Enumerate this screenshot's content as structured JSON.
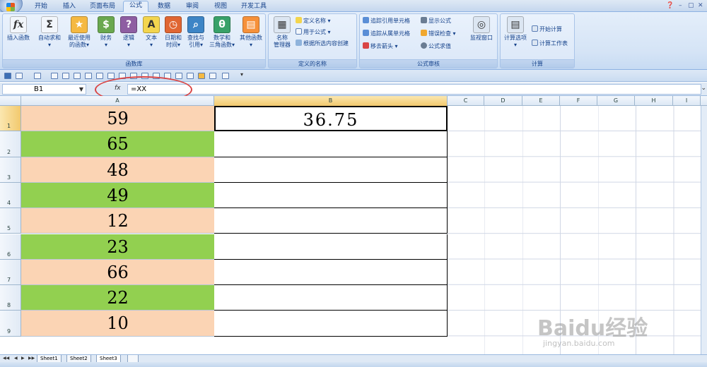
{
  "tabs": [
    "开始",
    "插入",
    "页面布局",
    "公式",
    "数据",
    "审阅",
    "视图",
    "开发工具"
  ],
  "active_tab": "公式",
  "ribbon": {
    "groups": [
      {
        "label": "函数库"
      },
      {
        "label": "定义的名称"
      },
      {
        "label": "公式审核"
      },
      {
        "label": "计算"
      }
    ],
    "function_library": [
      {
        "l1": "插入函数",
        "l2": "",
        "icon": "fx",
        "color": "#f2f6fb"
      },
      {
        "l1": "自动求和",
        "l2": "▾",
        "icon": "Σ",
        "color": "#f2f6fb"
      },
      {
        "l1": "最近使用",
        "l2": "的函数▾",
        "icon": "★",
        "color": "#f5b942"
      },
      {
        "l1": "财务",
        "l2": "▾",
        "icon": "$",
        "color": "#6aa84f"
      },
      {
        "l1": "逻辑",
        "l2": "▾",
        "icon": "?",
        "color": "#8e5ea2"
      },
      {
        "l1": "文本",
        "l2": "▾",
        "icon": "A",
        "color": "#f3d54e"
      },
      {
        "l1": "日期和",
        "l2": "时间▾",
        "icon": "◷",
        "color": "#e06633"
      },
      {
        "l1": "查找与",
        "l2": "引用▾",
        "icon": "⌕",
        "color": "#3d85c6"
      },
      {
        "l1": "数学和",
        "l2": "三角函数▾",
        "icon": "θ",
        "color": "#38a169"
      },
      {
        "l1": "其他函数",
        "l2": "▾",
        "icon": "▤",
        "color": "#f6913a"
      }
    ],
    "names": {
      "manager1": "名称",
      "manager2": "管理器",
      "define": "定义名称 ▾",
      "use_in": "用于公式 ▾",
      "create": "根据所选内容创建"
    },
    "audit": {
      "trace_prec": "追踪引用单元格",
      "trace_dep": "追踪从属单元格",
      "remove": "移去箭头 ▾",
      "show": "显示公式",
      "check": "错误检查 ▾",
      "eval": "公式求值",
      "watch": "监视窗口"
    },
    "calc": {
      "options1": "计算选项",
      "options2": "▾",
      "start": "开始计算",
      "sheet": "计算工作表"
    }
  },
  "formula_bar": {
    "name_box": "B1",
    "fx": "fx",
    "formula": "=XX"
  },
  "columns": [
    "A",
    "B",
    "C",
    "D",
    "E",
    "F",
    "G",
    "H",
    "I"
  ],
  "rows": [
    {
      "n": "1",
      "a": "59",
      "b": "36.75",
      "color": "#fbd4b4"
    },
    {
      "n": "2",
      "a": "65",
      "b": "",
      "color": "#92d050"
    },
    {
      "n": "3",
      "a": "48",
      "b": "",
      "color": "#fbd4b4"
    },
    {
      "n": "4",
      "a": "49",
      "b": "",
      "color": "#92d050"
    },
    {
      "n": "5",
      "a": "12",
      "b": "",
      "color": "#fbd4b4"
    },
    {
      "n": "6",
      "a": "23",
      "b": "",
      "color": "#92d050"
    },
    {
      "n": "7",
      "a": "66",
      "b": "",
      "color": "#fbd4b4"
    },
    {
      "n": "8",
      "a": "22",
      "b": "",
      "color": "#92d050"
    },
    {
      "n": "9",
      "a": "10",
      "b": "",
      "color": "#fbd4b4"
    }
  ],
  "sheets": [
    "Sheet1",
    "Sheet2",
    "Sheet3"
  ],
  "active_sheet": "Sheet3",
  "watermark": "Baidu经验",
  "watermark_sub": "jingyan.baidu.com"
}
